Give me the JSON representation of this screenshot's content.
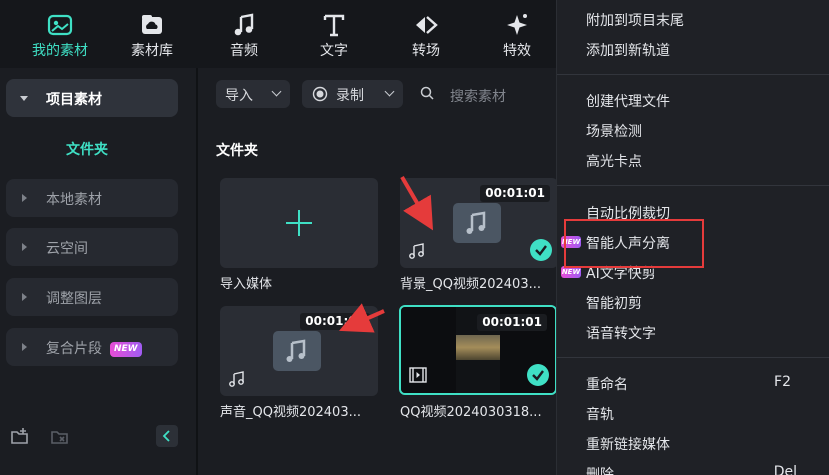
{
  "toolbar": {
    "items": [
      {
        "label": "我的素材",
        "icon": "media-icon",
        "active": true
      },
      {
        "label": "素材库",
        "icon": "cloud-library-icon",
        "active": false
      },
      {
        "label": "音频",
        "icon": "music-note-icon",
        "active": false
      },
      {
        "label": "文字",
        "icon": "text-icon",
        "active": false
      },
      {
        "label": "转场",
        "icon": "transition-icon",
        "active": false
      },
      {
        "label": "特效",
        "icon": "effects-sparkle-icon",
        "active": false
      }
    ]
  },
  "sidebar": {
    "project_media": "项目素材",
    "folder": "文件夹",
    "items": [
      {
        "label": "本地素材"
      },
      {
        "label": "云空间"
      },
      {
        "label": "调整图层"
      },
      {
        "label": "复合片段",
        "badge": "NEW"
      }
    ]
  },
  "media": {
    "import_label": "导入",
    "record_label": "录制",
    "search_placeholder": "搜索素材",
    "section_title": "文件夹",
    "import_media_label": "导入媒体",
    "clips": [
      {
        "name": "背景_QQ视频202403...",
        "duration": "00:01:01",
        "checked": true,
        "type": "audio"
      },
      {
        "name": "声音_QQ视频202403...",
        "duration": "00:01:01",
        "checked": false,
        "type": "audio"
      },
      {
        "name": "QQ视频2024030318...",
        "duration": "00:01:01",
        "checked": true,
        "type": "video"
      }
    ]
  },
  "context_menu": {
    "items": [
      {
        "label": "附加到项目末尾"
      },
      {
        "label": "添加到新轨道"
      },
      {
        "label": "创建代理文件"
      },
      {
        "label": "场景检测"
      },
      {
        "label": "高光卡点"
      },
      {
        "label": "自动比例裁切"
      },
      {
        "label": "智能人声分离",
        "badge": "NEW",
        "highlighted": true
      },
      {
        "label": "AI文字快剪",
        "badge": "NEW"
      },
      {
        "label": "智能初剪"
      },
      {
        "label": "语音转文字"
      },
      {
        "label": "重命名",
        "shortcut": "F2"
      },
      {
        "label": "音轨"
      },
      {
        "label": "重新链接媒体"
      },
      {
        "label": "删除",
        "shortcut": "Del"
      }
    ]
  },
  "colors": {
    "accent": "#3fe0c5",
    "highlight_box": "#e53b3b",
    "new_badge": "#c050e0"
  }
}
